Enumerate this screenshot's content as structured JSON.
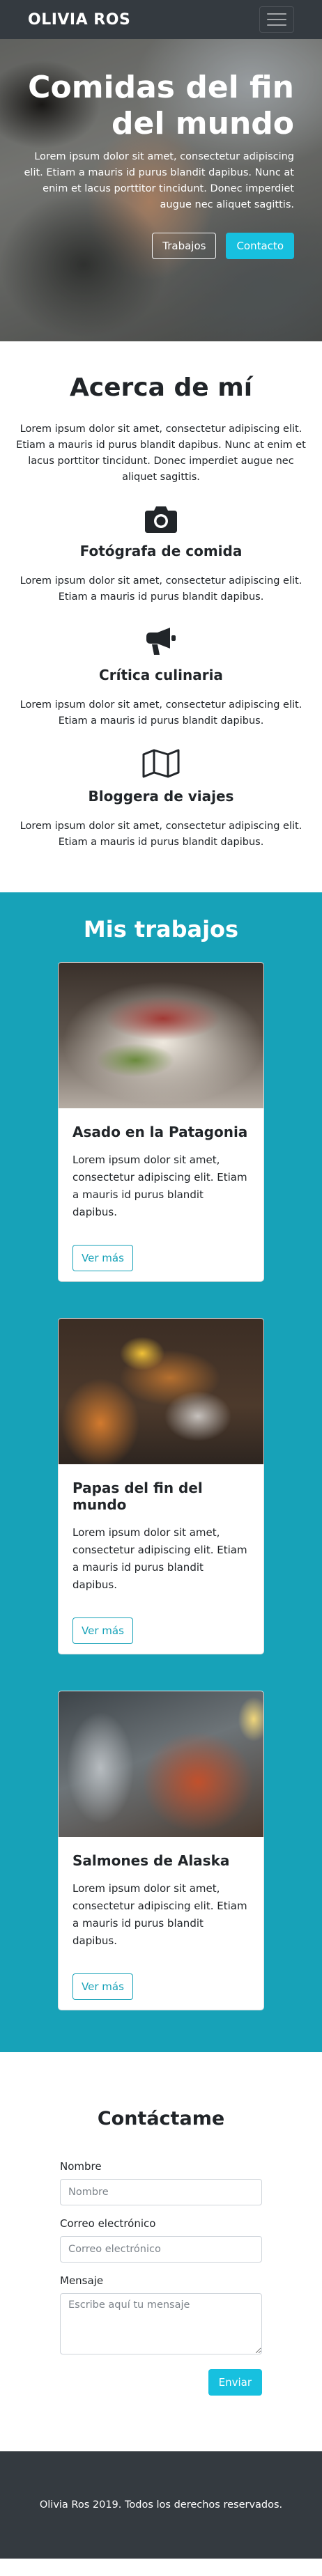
{
  "navbar": {
    "brand": "OLIVIA ROS",
    "toggle_icon": "hamburger-menu-icon"
  },
  "hero": {
    "title": "Comidas del fin del mundo",
    "text": "Lorem ipsum dolor sit amet, consectetur adipiscing elit. Etiam a mauris id purus blandit dapibus. Nunc at enim et lacus porttitor tincidunt. Donec imperdiet augue nec aliquet sagittis.",
    "btn_works": "Trabajos",
    "btn_contact": "Contacto"
  },
  "about": {
    "title": "Acerca de mí",
    "intro": "Lorem ipsum dolor sit amet, consectetur adipiscing elit. Etiam a mauris id purus blandit dapibus. Nunc at enim et lacus porttitor tincidunt. Donec imperdiet augue nec aliquet sagittis.",
    "services": [
      {
        "icon": "camera-icon",
        "title": "Fotógrafa de comida",
        "text": "Lorem ipsum dolor sit amet, consectetur adipiscing elit. Etiam a mauris id purus blandit dapibus."
      },
      {
        "icon": "bullhorn-icon",
        "title": "Crítica culinaria",
        "text": "Lorem ipsum dolor sit amet, consectetur adipiscing elit. Etiam a mauris id purus blandit dapibus."
      },
      {
        "icon": "map-icon",
        "title": "Bloggera de viajes",
        "text": "Lorem ipsum dolor sit amet, consectetur adipiscing elit. Etiam a mauris id purus blandit dapibus."
      }
    ]
  },
  "works": {
    "title": "Mis trabajos",
    "cards": [
      {
        "title": "Asado en la Patagonia",
        "text": "Lorem ipsum dolor sit amet, consectetur adipiscing elit. Etiam a mauris id purus blandit dapibus.",
        "button": "Ver más"
      },
      {
        "title": "Papas del fin del mundo",
        "text": "Lorem ipsum dolor sit amet, consectetur adipiscing elit. Etiam a mauris id purus blandit dapibus.",
        "button": "Ver más"
      },
      {
        "title": "Salmones de Alaska",
        "text": "Lorem ipsum dolor sit amet, consectetur adipiscing elit. Etiam a mauris id purus blandit dapibus.",
        "button": "Ver más"
      }
    ]
  },
  "contact": {
    "title": "Contáctame",
    "name_label": "Nombre",
    "name_placeholder": "Nombre",
    "email_label": "Correo electrónico",
    "email_placeholder": "Correo electrónico",
    "message_label": "Mensaje",
    "message_placeholder": "Escribe aquí tu mensaje",
    "submit": "Enviar"
  },
  "footer": {
    "text": "Olivia Ros 2019. Todos los derechos reservados."
  },
  "colors": {
    "dark": "#343a40",
    "info": "#17a2b8",
    "accent": "#17c0df"
  }
}
